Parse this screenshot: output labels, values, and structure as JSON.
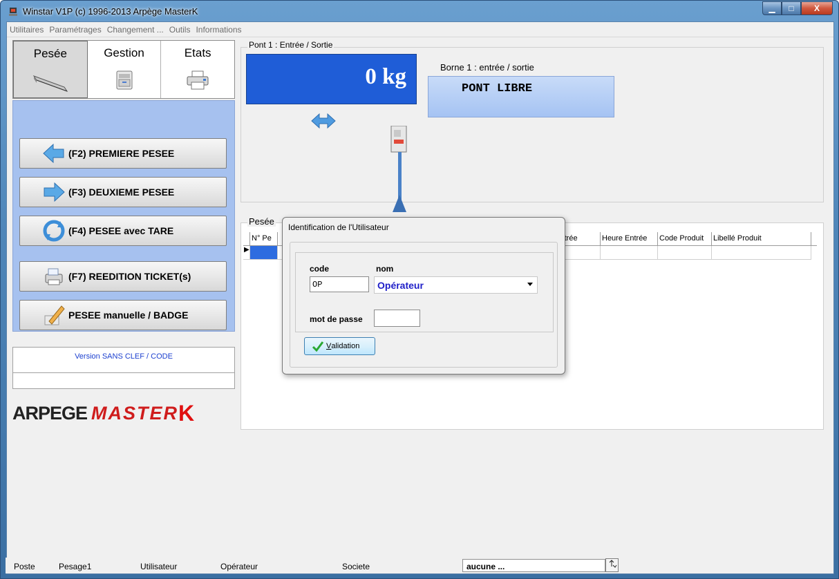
{
  "window": {
    "title": "Winstar V1P (c) 1996-2013 Arpège MasterK",
    "minimize_glyph": "▁",
    "maximize_glyph": "□",
    "close_glyph": "X"
  },
  "menu": {
    "items": [
      "Utilitaires",
      "Paramétrages",
      "Changement ...",
      "Outils",
      "Informations"
    ]
  },
  "tabs": [
    {
      "label": "Pesée",
      "icon": "scale-icon",
      "active": true
    },
    {
      "label": "Gestion",
      "icon": "cabinet-icon",
      "active": false
    },
    {
      "label": "Etats",
      "icon": "printer-icon",
      "active": false
    }
  ],
  "actions": {
    "first_weigh": "(F2) PREMIERE PESEE",
    "second_weigh": "(F3) DEUXIEME PESEE",
    "tare_weigh": "(F4) PESEE avec TARE",
    "reprint": "(F7) REEDITION TICKET(s)",
    "manual": "PESEE manuelle / BADGE"
  },
  "version": {
    "text": "Version SANS CLEF / CODE",
    "text_color": "#1b3fcf"
  },
  "logo": {
    "part1": "ARPEGE",
    "part2": "MASTER",
    "part3": "K",
    "brand_color": "#cf1c1c"
  },
  "pont": {
    "legend": "Pont 1 : Entrée / Sortie",
    "weight": "0 kg",
    "weight_bg": "#1f5dd7",
    "borne_label": "Borne 1 : entrée / sortie",
    "borne_status": "PONT LIBRE"
  },
  "pesee": {
    "legend": "Pesée",
    "columns": [
      "N° Pe",
      "",
      "e Entrée",
      "Heure Entrée",
      "Code Produit",
      "Libellé Produit"
    ]
  },
  "dialog": {
    "title": "Identification de l'Utilisateur",
    "code_label": "code",
    "nom_label": "nom",
    "code_value": "OP",
    "nom_value": "Opérateur",
    "password_label": "mot de passe",
    "password_value": "",
    "validate_prefix": "V",
    "validate_rest": "alidation"
  },
  "status": {
    "poste_label": "Poste",
    "poste_value": "Pesage1",
    "user_label": "Utilisateur",
    "user_value": "Opérateur",
    "company_label": "Societe",
    "company_value": "aucune ..."
  }
}
